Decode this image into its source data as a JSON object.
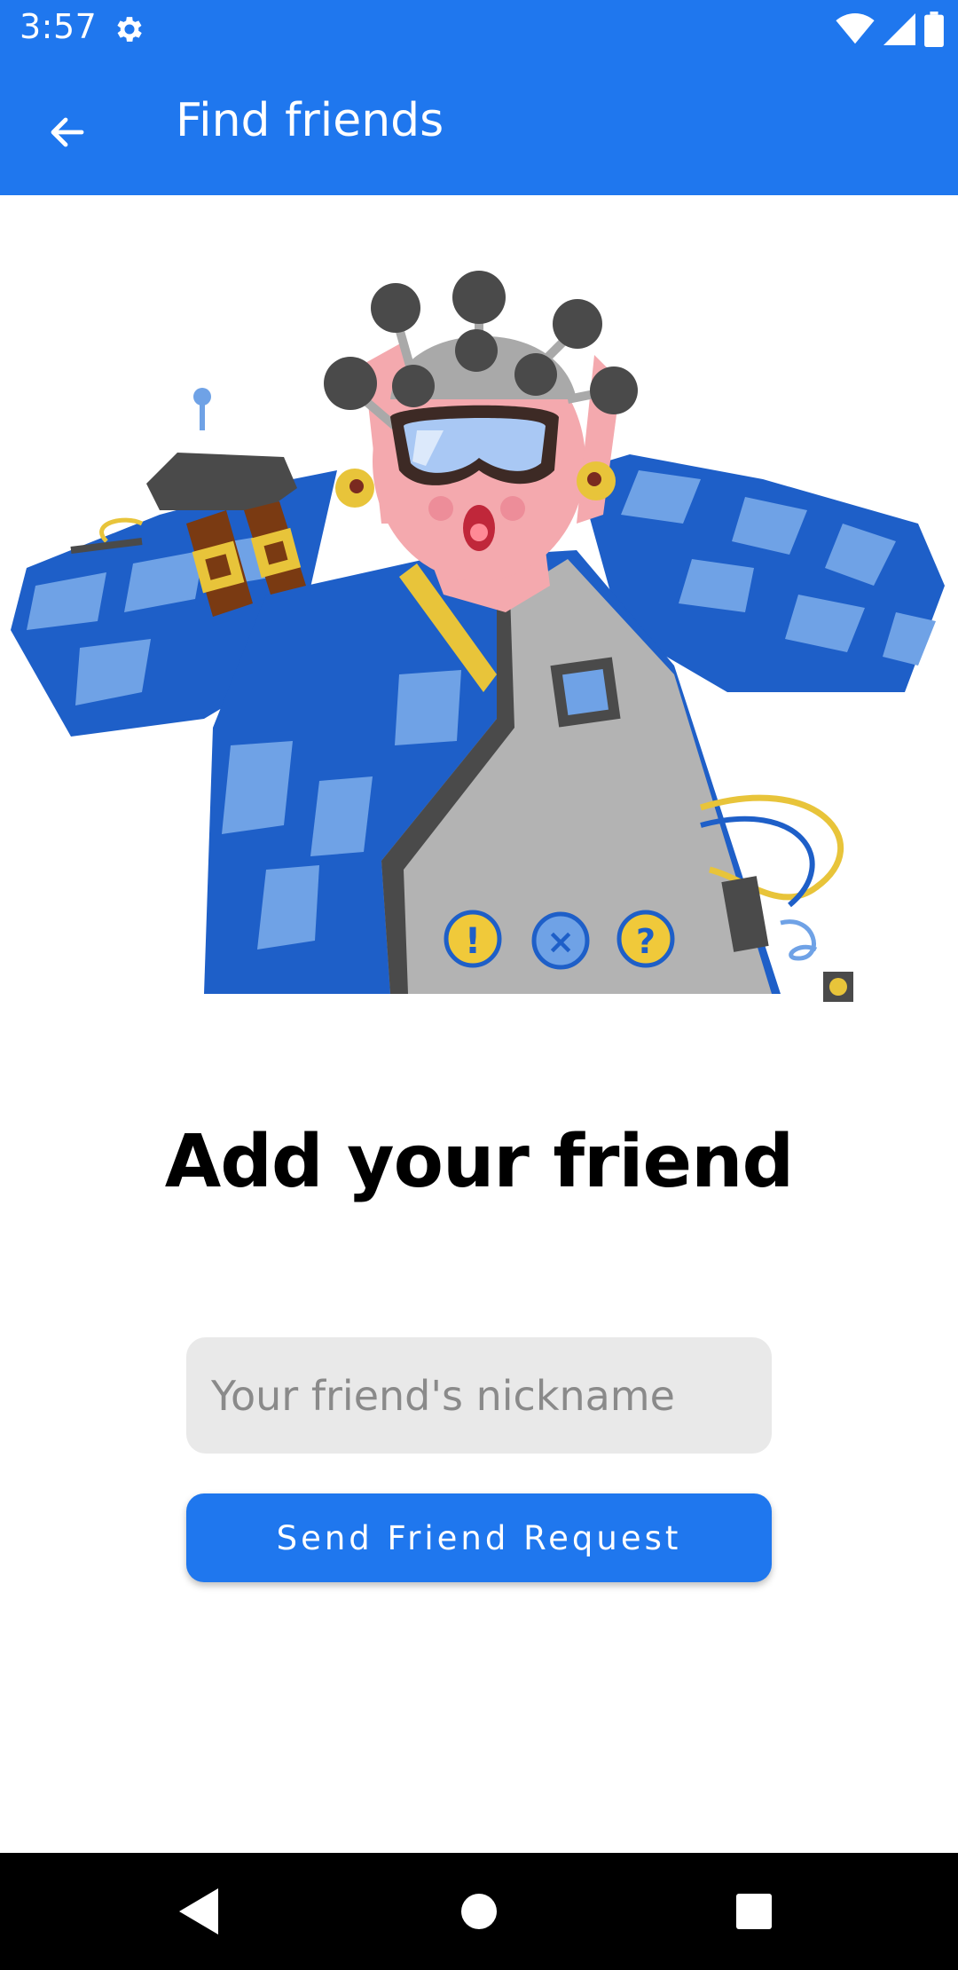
{
  "status_bar": {
    "time": "3:57",
    "icons": [
      "settings-icon",
      "wifi-icon",
      "signal-icon",
      "battery-icon"
    ]
  },
  "app_bar": {
    "title": "Find friends",
    "back_icon": "arrow-back-icon"
  },
  "colors": {
    "primary": "#1f77ee",
    "input_background": "#e9e9e9",
    "nav_background": "#000000"
  },
  "main": {
    "heading": "Add your friend",
    "nickname_placeholder": "Your friend's nickname",
    "nickname_value": "",
    "send_button_label": "Send Friend Request"
  },
  "nav_bar": {
    "buttons": [
      "back-triangle-icon",
      "home-circle-icon",
      "recents-square-icon"
    ]
  }
}
